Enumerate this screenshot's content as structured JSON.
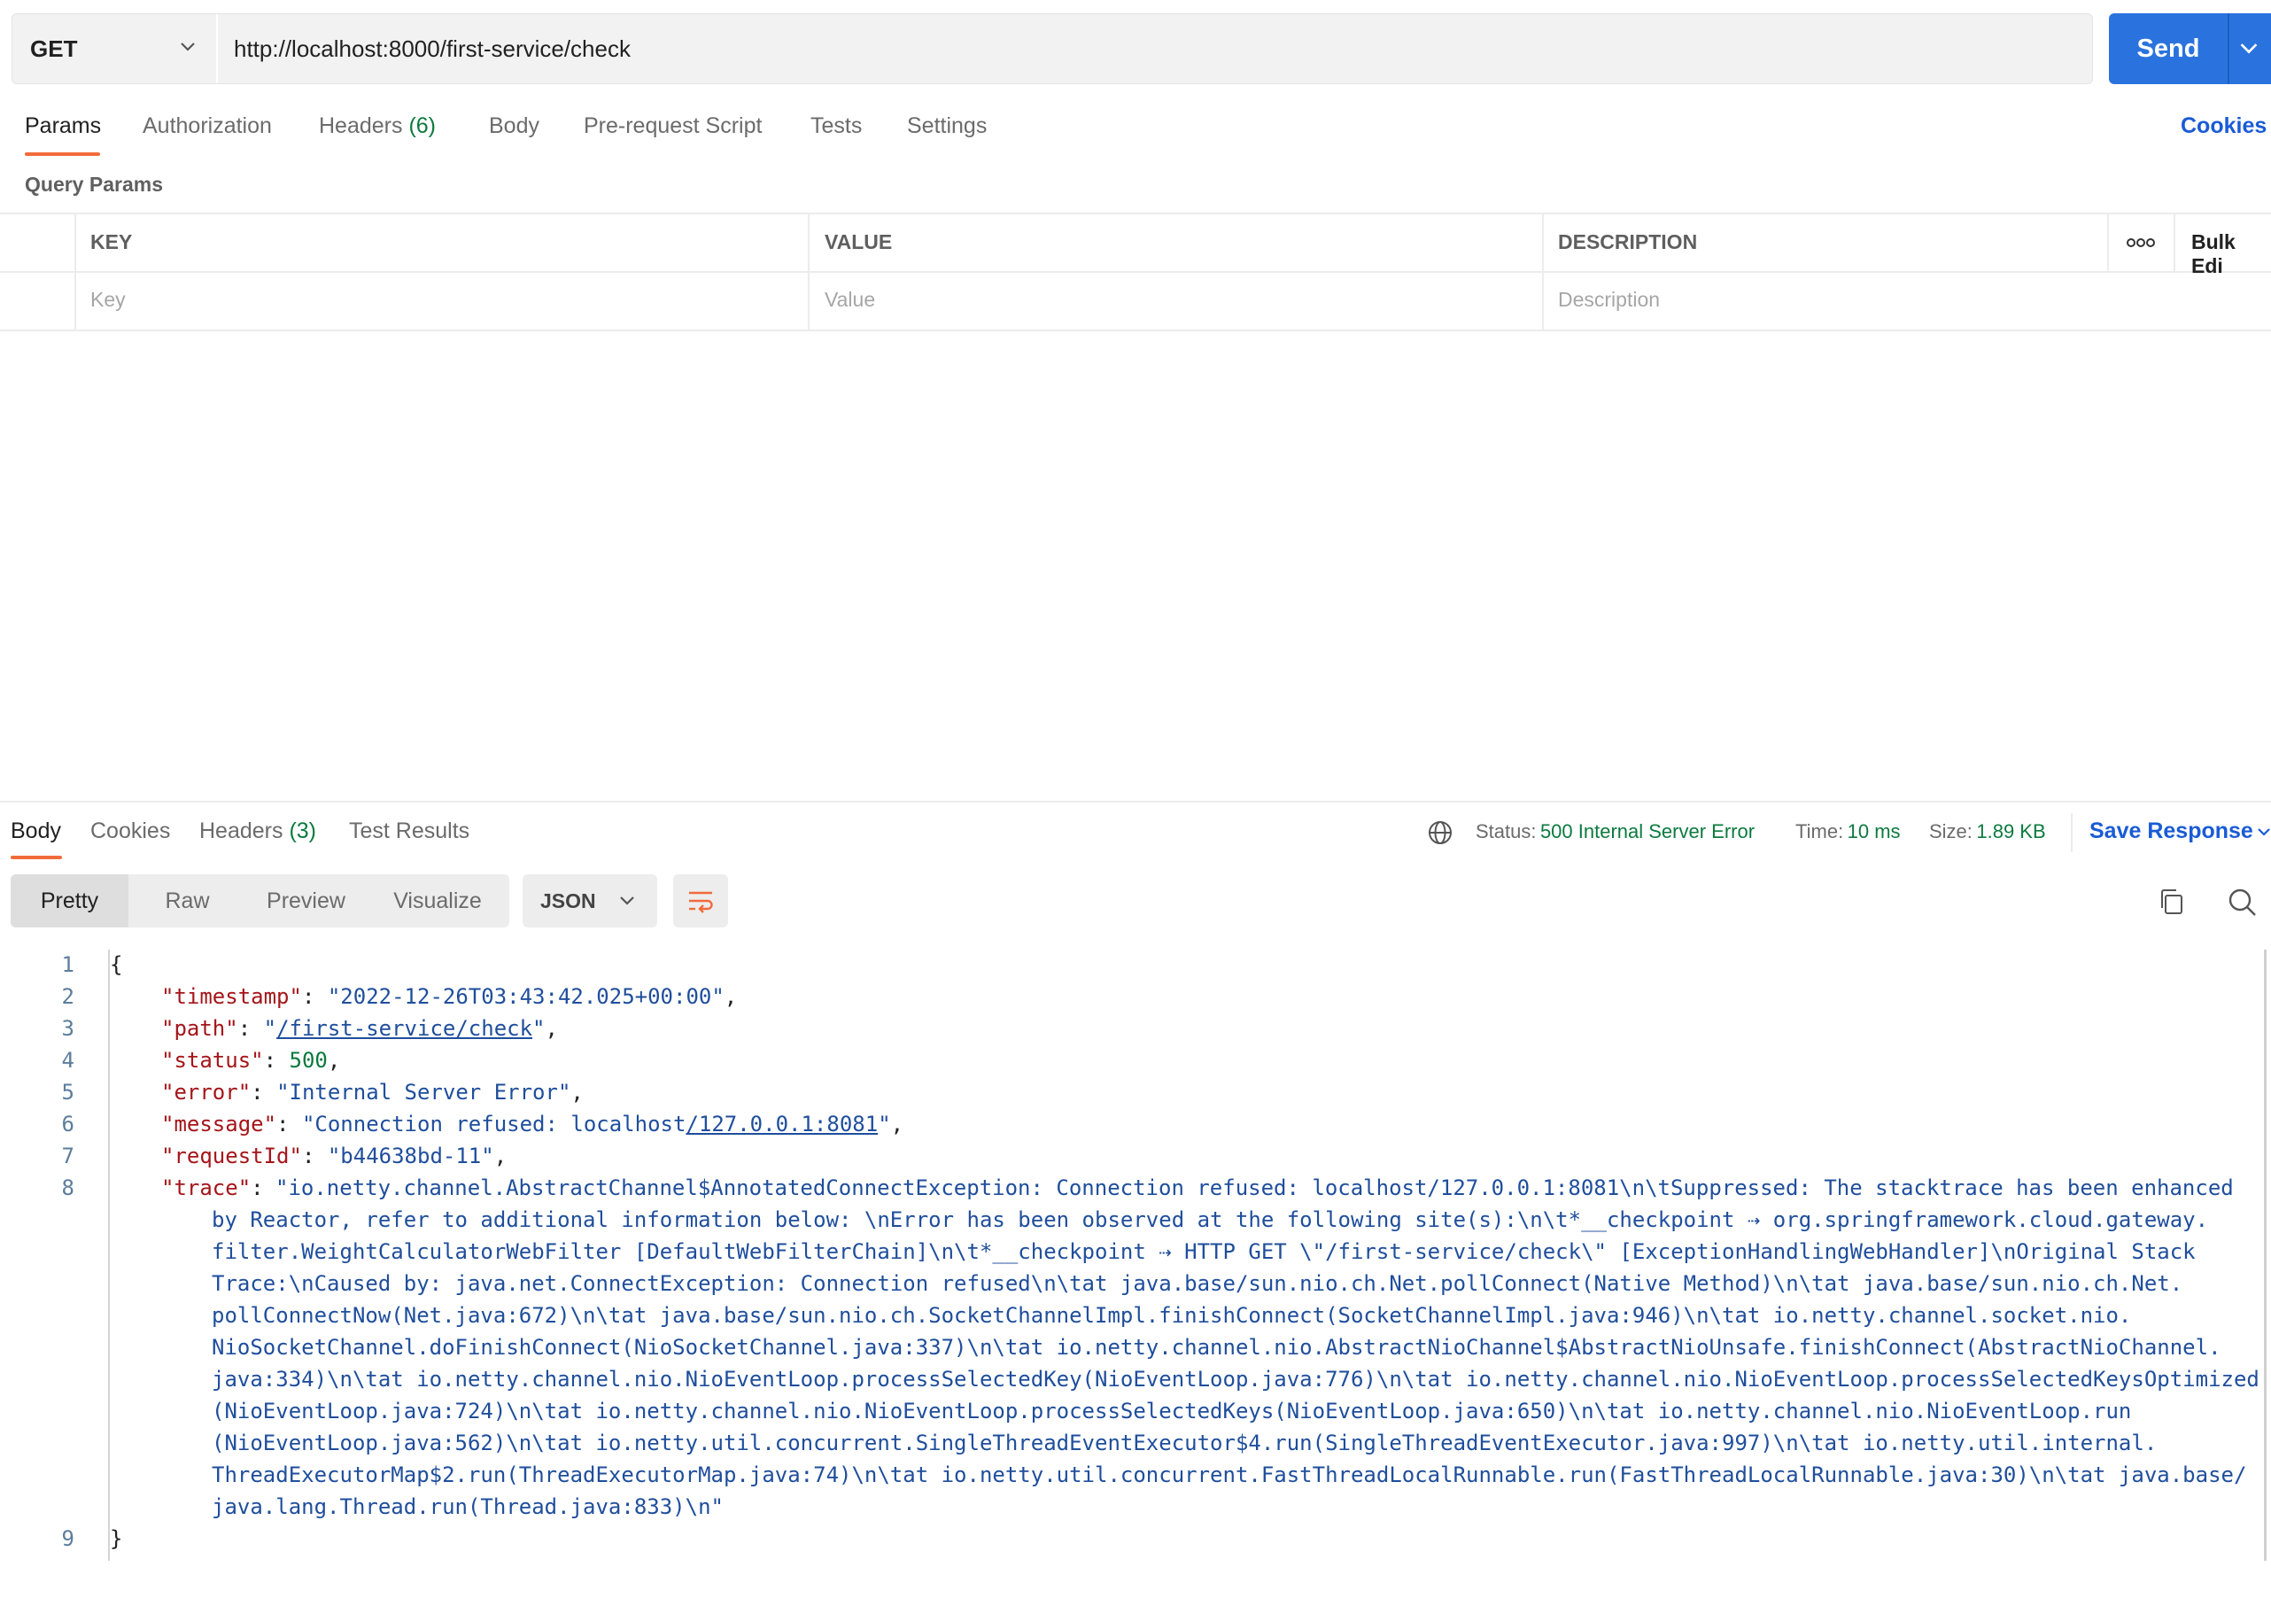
{
  "request": {
    "method": "GET",
    "url": "http://localhost:8000/first-service/check",
    "send_label": "Send"
  },
  "request_tabs": [
    {
      "label": "Params"
    },
    {
      "label": "Authorization"
    },
    {
      "label": "Headers",
      "count": "(6)"
    },
    {
      "label": "Body"
    },
    {
      "label": "Pre-request Script"
    },
    {
      "label": "Tests"
    },
    {
      "label": "Settings"
    }
  ],
  "cookies_label": "Cookies",
  "query_params": {
    "title": "Query Params",
    "columns": {
      "key": "KEY",
      "value": "VALUE",
      "description": "DESCRIPTION"
    },
    "bulk_edit": "Bulk Edi",
    "placeholders": {
      "key": "Key",
      "value": "Value",
      "description": "Description"
    }
  },
  "response_tabs": [
    {
      "label": "Body"
    },
    {
      "label": "Cookies"
    },
    {
      "label": "Headers",
      "count": "(3)"
    },
    {
      "label": "Test Results"
    }
  ],
  "response_meta": {
    "status_label": "Status:",
    "status_value": "500 Internal Server Error",
    "time_label": "Time:",
    "time_value": "10 ms",
    "size_label": "Size:",
    "size_value": "1.89 KB",
    "save_label": "Save Response"
  },
  "view_modes": [
    "Pretty",
    "Raw",
    "Preview",
    "Visualize"
  ],
  "format": "JSON",
  "body": {
    "line_numbers": [
      "1",
      "2",
      "3",
      "4",
      "5",
      "6",
      "7",
      "8",
      "9"
    ],
    "open_brace": "{",
    "close_brace": "}",
    "timestamp_key": "\"timestamp\"",
    "timestamp_val": "\"2022-12-26T03:43:42.025+00:00\"",
    "path_key": "\"path\"",
    "path_val": "/first-service/check",
    "status_key": "\"status\"",
    "status_val": "500",
    "error_key": "\"error\"",
    "error_val": "\"Internal Server Error\"",
    "message_key": "\"message\"",
    "message_val_a": "\"Connection refused: localhost",
    "message_val_b": "/127.0.0.1:8081",
    "request_id_key": "\"requestId\"",
    "request_id_val": "\"b44638bd-11\"",
    "trace_key": "\"trace\"",
    "trace_lines": [
      "\"io.netty.channel.AbstractChannel$AnnotatedConnectException: Connection refused: localhost/127.0.0.1:8081\\n\\tSuppressed: The stacktrace has been enhanced",
      "by Reactor, refer to additional information below: \\nError has been observed at the following site(s):\\n\\t*__checkpoint ⇢ org.springframework.cloud.gateway.",
      "filter.WeightCalculatorWebFilter [DefaultWebFilterChain]\\n\\t*__checkpoint ⇢ HTTP GET \\\"/first-service/check\\\" [ExceptionHandlingWebHandler]\\nOriginal Stack",
      "Trace:\\nCaused by: java.net.ConnectException: Connection refused\\n\\tat java.base/sun.nio.ch.Net.pollConnect(Native Method)\\n\\tat java.base/sun.nio.ch.Net.",
      "pollConnectNow(Net.java:672)\\n\\tat java.base/sun.nio.ch.SocketChannelImpl.finishConnect(SocketChannelImpl.java:946)\\n\\tat io.netty.channel.socket.nio.",
      "NioSocketChannel.doFinishConnect(NioSocketChannel.java:337)\\n\\tat io.netty.channel.nio.AbstractNioChannel$AbstractNioUnsafe.finishConnect(AbstractNioChannel.",
      "java:334)\\n\\tat io.netty.channel.nio.NioEventLoop.processSelectedKey(NioEventLoop.java:776)\\n\\tat io.netty.channel.nio.NioEventLoop.processSelectedKeysOptimized",
      "(NioEventLoop.java:724)\\n\\tat io.netty.channel.nio.NioEventLoop.processSelectedKeys(NioEventLoop.java:650)\\n\\tat io.netty.channel.nio.NioEventLoop.run",
      "(NioEventLoop.java:562)\\n\\tat io.netty.util.concurrent.SingleThreadEventExecutor$4.run(SingleThreadEventExecutor.java:997)\\n\\tat io.netty.util.internal.",
      "ThreadExecutorMap$2.run(ThreadExecutorMap.java:74)\\n\\tat io.netty.util.concurrent.FastThreadLocalRunnable.run(FastThreadLocalRunnable.java:30)\\n\\tat java.base/",
      "java.lang.Thread.run(Thread.java:833)\\n\""
    ]
  }
}
